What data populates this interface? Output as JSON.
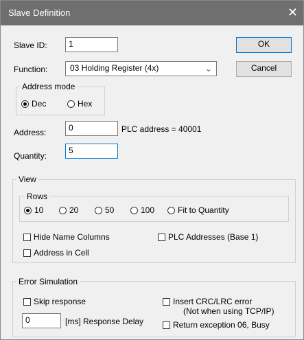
{
  "window": {
    "title": "Slave Definition",
    "close_glyph": "✕"
  },
  "slave_id": {
    "label": "Slave ID:",
    "value": "1"
  },
  "buttons": {
    "ok": "OK",
    "cancel": "Cancel"
  },
  "function": {
    "label": "Function:",
    "selected": "03 Holding Register (4x)"
  },
  "address_mode": {
    "title": "Address mode",
    "options": [
      "Dec",
      "Hex"
    ],
    "selected": "Dec"
  },
  "address": {
    "label": "Address:",
    "value": "0",
    "plc_info": "PLC address = 40001"
  },
  "quantity": {
    "label": "Quantity:",
    "value": "5"
  },
  "view": {
    "title": "View",
    "rows_title": "Rows",
    "rows_options": [
      "10",
      "20",
      "50",
      "100",
      "Fit to Quantity"
    ],
    "rows_selected": "10",
    "hide_name_columns": "Hide Name Columns",
    "plc_addresses": "PLC Addresses (Base 1)",
    "address_in_cell": "Address in Cell"
  },
  "error_sim": {
    "title": "Error Simulation",
    "skip_response": "Skip response",
    "insert_crc": "Insert CRC/LRC error",
    "insert_crc_note": "(Not when using TCP/IP)",
    "delay_value": "0",
    "delay_label": "[ms] Response Delay",
    "return_exception": "Return exception 06, Busy"
  }
}
